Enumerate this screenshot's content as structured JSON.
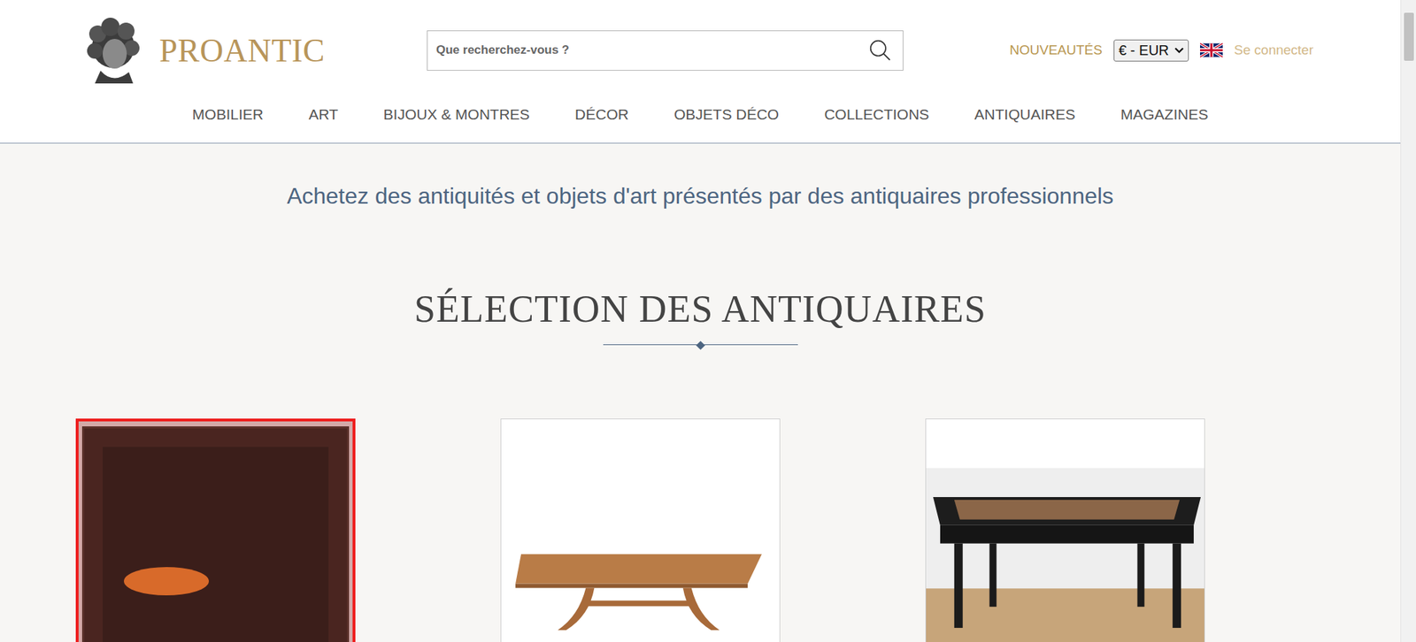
{
  "logo": {
    "name": "PROANTIC"
  },
  "search": {
    "placeholder": "Que recherchez-vous ?"
  },
  "top_links": {
    "new": "NOUVEAUTÉS",
    "currency": "€ - EUR",
    "login": "Se connecter"
  },
  "nav": [
    "MOBILIER",
    "ART",
    "BIJOUX & MONTRES",
    "DÉCOR",
    "OBJETS DÉCO",
    "COLLECTIONS",
    "ANTIQUAIRES",
    "MAGAZINES"
  ],
  "tagline": "Achetez des antiquités et objets d'art présentés par des antiquaires professionnels",
  "section": {
    "title": "SÉLECTION DES ANTIQUAIRES"
  },
  "cards": [
    {
      "kind": "painting",
      "highlighted": true
    },
    {
      "kind": "table",
      "highlighted": false
    },
    {
      "kind": "desk",
      "highlighted": false
    }
  ]
}
